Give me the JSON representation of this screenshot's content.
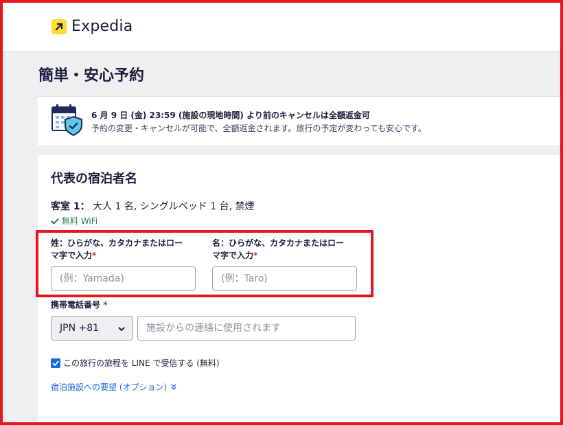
{
  "header": {
    "logo_text": "Expedia",
    "logo_icon": "arrow-icon"
  },
  "page": {
    "title": "簡単・安心予約"
  },
  "cancellation": {
    "headline": "6 月 9 日 (金) 23:59 (施設の現地時間) より前のキャンセルは全額返金可",
    "detail": "予約の変更・キャンセルが可能で、全額返金されます。旅行の予定が変わっても安心です。",
    "icon": "calendar-shield-icon"
  },
  "guest_form": {
    "title": "代表の宿泊者名",
    "room_label": "客室 1：",
    "room_detail": "大人 1 名, シングルベッド 1 台, 禁煙",
    "amenity": "無料 WiFi",
    "last_name": {
      "label_line1": "姓：ひらがな、カタカナまたはロー",
      "label_line2": "マ字で入力",
      "required_mark": "*",
      "placeholder": "(例：Yamada)",
      "value": ""
    },
    "first_name": {
      "label_line1": "名：ひらがな、カタカナまたはロー",
      "label_line2": "マ字で入力",
      "required_mark": "*",
      "placeholder": "(例：Taro)",
      "value": ""
    },
    "phone": {
      "label": "携帯電話番号",
      "required_mark": "*",
      "country_code": "JPN +81",
      "placeholder": "施設からの連絡に使用されます",
      "value": ""
    },
    "line_opt_in": {
      "label": "この旅行の旅程を LINE で受信する (無料)",
      "checked": true
    },
    "special_requests_link": "宿泊施設への要望 (オプション)"
  },
  "colors": {
    "brand_yellow": "#fddb32",
    "link_blue": "#1668e3",
    "success_green": "#227950",
    "highlight_red": "#e3181e",
    "page_bg": "#efeff1"
  }
}
